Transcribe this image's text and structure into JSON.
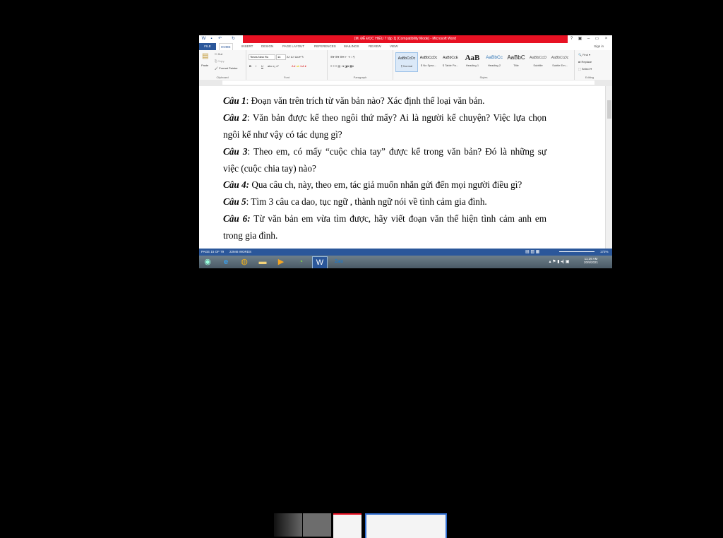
{
  "window": {
    "title": "[M. ĐỀ ĐỌC HIỂU 7 tập 1] [Compatibility Mode] - Microsoft Word",
    "controls": [
      "?",
      "▣",
      "–",
      "▭",
      "×"
    ]
  },
  "tabs": [
    "FILE",
    "HOME",
    "INSERT",
    "DESIGN",
    "PAGE LAYOUT",
    "REFERENCES",
    "MAILINGS",
    "REVIEW",
    "VIEW"
  ],
  "signin": "Sign in",
  "ribbon": {
    "clipboard": {
      "paste": "Paste",
      "cut": "Cut",
      "copy": "Copy",
      "format_painter": "Format Painter",
      "label": "Clipboard"
    },
    "font": {
      "name": "Times New Ro",
      "size": "14",
      "label": "Font"
    },
    "paragraph_label": "Paragraph",
    "styles": [
      {
        "preview": "AaBbCcDc",
        "name": "¶ Normal"
      },
      {
        "preview": "AaBbCcDc",
        "name": "¶ No Spac..."
      },
      {
        "preview": "AaBbCcE",
        "name": "¶ Table Pa..."
      },
      {
        "preview": "AaB",
        "name": "Heading 1"
      },
      {
        "preview": "AaBbCc",
        "name": "Heading 2"
      },
      {
        "preview": "AaBbC",
        "name": "Title"
      },
      {
        "preview": "AaBbCcD",
        "name": "Subtitle"
      },
      {
        "preview": "AaBbCcDc",
        "name": "Subtle Em..."
      }
    ],
    "styles_label": "Styles",
    "editing": {
      "find": "Find",
      "replace": "Replace",
      "select": "Select",
      "label": "Editing"
    }
  },
  "document": {
    "lines": [
      {
        "label": "Câu 1",
        "text": ": Đoạn văn trên trích từ văn bản nào? Xác định thể loại văn bản."
      },
      {
        "label": "Câu 2",
        "text": ": Văn bản được kể theo ngôi thứ mấy? Ai là người kể chuyện? Việc lựa chọn"
      },
      {
        "label": "",
        "text": "ngôi kể như vậy có tác dụng gì?"
      },
      {
        "label": "Câu 3",
        "text": ": Theo em, có mấy “cuộc chia tay” được kể trong văn bản? Đó là những sự"
      },
      {
        "label": "",
        "text": "việc (cuộc chia tay) nào?"
      },
      {
        "label": "Câu 4:",
        "text": " Qua câu ch, này, theo em, tác giả muốn nhắn gửi đến mọi người điều gì?"
      },
      {
        "label": "Câu 5",
        "text": ": Tìm 3 câu ca dao, tục ngữ , thành ngữ nói về tình cảm gia đình."
      },
      {
        "label": "Câu 6:",
        "text": " Từ văn bản em vừa tìm được, hãy viết đoạn văn thể hiện tình cảm anh em"
      },
      {
        "label": "",
        "text": "trong gia đình."
      }
    ]
  },
  "status": {
    "page": "PAGE 15 OF 79",
    "words": "22946 WORDS",
    "zoom": "172%"
  },
  "taskbar": {
    "time": "11:29 AM",
    "date": "20/9/2021"
  }
}
